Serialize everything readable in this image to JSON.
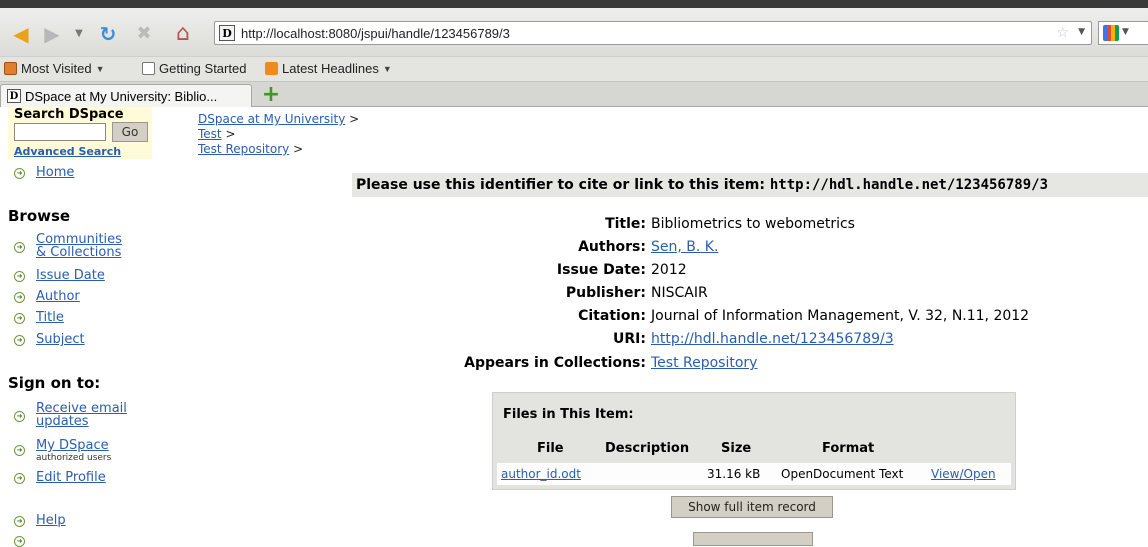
{
  "browser": {
    "url": "http://localhost:8080/jspui/handle/123456789/3",
    "bookmarks": [
      "Most Visited",
      "Getting Started",
      "Latest Headlines"
    ],
    "tab_title": "DSpace at My University: Biblio...",
    "site_icon_letter": "D"
  },
  "sidebar": {
    "search_title": "Search DSpace",
    "go_label": "Go",
    "advanced_search": "Advanced Search",
    "home": "Home",
    "browse_heading": "Browse",
    "browse_items": [
      "Communities",
      "& Collections",
      "Issue Date",
      "Author",
      "Title",
      "Subject"
    ],
    "signon_heading": "Sign on to:",
    "signon_items": [
      "Receive email",
      "updates",
      "My DSpace",
      "authorized users",
      "Edit Profile"
    ],
    "help": "Help"
  },
  "breadcrumb": [
    "DSpace at My University",
    "Test",
    "Test Repository"
  ],
  "cite": {
    "label": "Please use this identifier to cite or link to this item:",
    "url": "http://hdl.handle.net/123456789/3"
  },
  "metadata": [
    {
      "label": "Title:",
      "value": "Bibliometrics to webometrics"
    },
    {
      "label": "Authors:",
      "value": "Sen, B. K."
    },
    {
      "label": "Issue Date:",
      "value": "2012"
    },
    {
      "label": "Publisher:",
      "value": "NISCAIR"
    },
    {
      "label": "Citation:",
      "value": "Journal of Information Management, V. 32, N.11, 2012"
    },
    {
      "label": "URI:",
      "value": "http://hdl.handle.net/123456789/3"
    },
    {
      "label": "Appears in Collections:",
      "value": "Test Repository"
    }
  ],
  "files": {
    "title": "Files in This Item:",
    "headers": [
      "File",
      "Description",
      "Size",
      "Format"
    ],
    "row": {
      "file": "author_id.odt",
      "description": "",
      "size": "31.16 kB",
      "format": "OpenDocument Text",
      "action": "View/Open"
    }
  },
  "show_full_record": "Show full item record"
}
